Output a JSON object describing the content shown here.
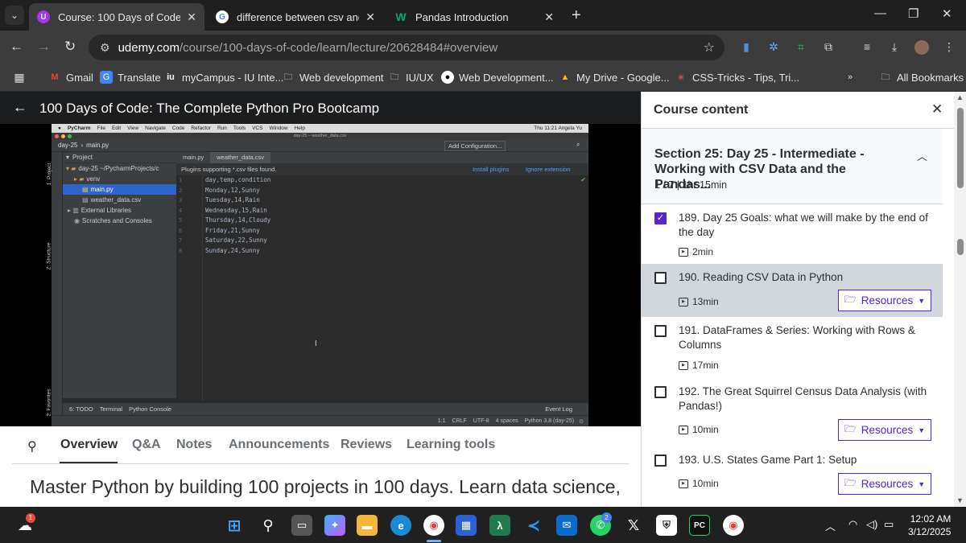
{
  "browser": {
    "tabs": [
      {
        "title": "Course: 100 Days of Code: The",
        "favicon": "udemy-icon",
        "active": true
      },
      {
        "title": "difference between csv and txt",
        "favicon": "google-icon",
        "active": false
      },
      {
        "title": "Pandas Introduction",
        "favicon": "w3schools-icon",
        "active": false
      }
    ],
    "url_host": "udemy.com",
    "url_path": "/course/100-days-of-code/learn/lecture/20628484#overview",
    "bookmarks": [
      "Gmail",
      "Translate",
      "myCampus - IU Inte...",
      "Web development",
      "IU/UX",
      "Web Development...",
      "My Drive - Google...",
      "CSS-Tricks - Tips, Tri...",
      "All Bookmarks"
    ]
  },
  "course": {
    "title": "100 Days of Code: The Complete Python Pro Bootcamp"
  },
  "pycharm": {
    "menu": [
      "PyCharm",
      "File",
      "Edit",
      "View",
      "Navigate",
      "Code",
      "Refactor",
      "Run",
      "Tools",
      "VCS",
      "Window",
      "Help"
    ],
    "menu_right": "Thu 11:21  Angela Yu",
    "window_title": "day-25 – weather_data.csv",
    "breadcrumb_project": "day-25",
    "breadcrumb_file": "main.py",
    "add_config": "Add Configuration...",
    "project_label": "Project",
    "tree": [
      {
        "label": "day-25 ~/PycharmProjects/c",
        "indent": 4,
        "type": "folder"
      },
      {
        "label": "venv",
        "indent": 14,
        "type": "folder"
      },
      {
        "label": "main.py",
        "indent": 24,
        "type": "file",
        "selected": true
      },
      {
        "label": "weather_data.csv",
        "indent": 24,
        "type": "file"
      },
      {
        "label": "External Libraries",
        "indent": 6,
        "type": "lib"
      },
      {
        "label": "Scratches and Consoles",
        "indent": 14,
        "type": "lib"
      }
    ],
    "editor_tabs": [
      "main.py",
      "weather_data.csv"
    ],
    "plugin_notice": "Plugins supporting *.csv files found.",
    "install_plugins": "Install plugins",
    "ignore_extension": "Ignore extension",
    "code_lines": [
      "day,temp,condition",
      "Monday,12,Sunny",
      "Tuesday,14,Rain",
      "Wednesday,15,Rain",
      "Thursday,14,Cloudy",
      "Friday,21,Sunny",
      "Saturday,22,Sunny",
      "Sunday,24,Sunny"
    ],
    "line_numbers": [
      "1",
      "2",
      "3",
      "4",
      "5",
      "6",
      "7",
      "8"
    ],
    "side_labels": [
      "1: Project",
      "Z: Structure",
      "2: Favorites"
    ],
    "bottom_tools": [
      "6: TODO",
      "Terminal",
      "Python Console"
    ],
    "event_log": "Event Log",
    "status": [
      "1:1",
      "CRLF",
      "UTF-8",
      "4 spaces",
      "Python 3.8 (day-25)"
    ]
  },
  "lower_tabs": [
    "Overview",
    "Q&A",
    "Notes",
    "Announcements",
    "Reviews",
    "Learning tools"
  ],
  "overview_text": "Master Python by building 100 projects in 100 days. Learn data science,",
  "sidebar": {
    "title": "Course content",
    "section_title": "Section 25: Day 25 - Intermediate - Working with CSV Data and the Pandas...",
    "section_meta": "1 / 7 | 1hr 15min",
    "lectures": [
      {
        "title": "189. Day 25 Goals: what we will make by the end of the day",
        "duration": "2min",
        "checked": true,
        "resources": false
      },
      {
        "title": "190. Reading CSV Data in Python",
        "duration": "13min",
        "checked": false,
        "resources": true,
        "current": true
      },
      {
        "title": "191. DataFrames & Series: Working with Rows & Columns",
        "duration": "17min",
        "checked": false,
        "resources": false
      },
      {
        "title": "192. The Great Squirrel Census Data Analysis (with Pandas!)",
        "duration": "10min",
        "checked": false,
        "resources": true
      },
      {
        "title": "193. U.S. States Game Part 1: Setup",
        "duration": "10min",
        "checked": false,
        "resources": true
      }
    ],
    "resources_label": "Resources"
  },
  "taskbar": {
    "time": "12:02 AM",
    "date": "3/12/2025",
    "weather_badge": "1",
    "whatsapp_badge": "2"
  }
}
